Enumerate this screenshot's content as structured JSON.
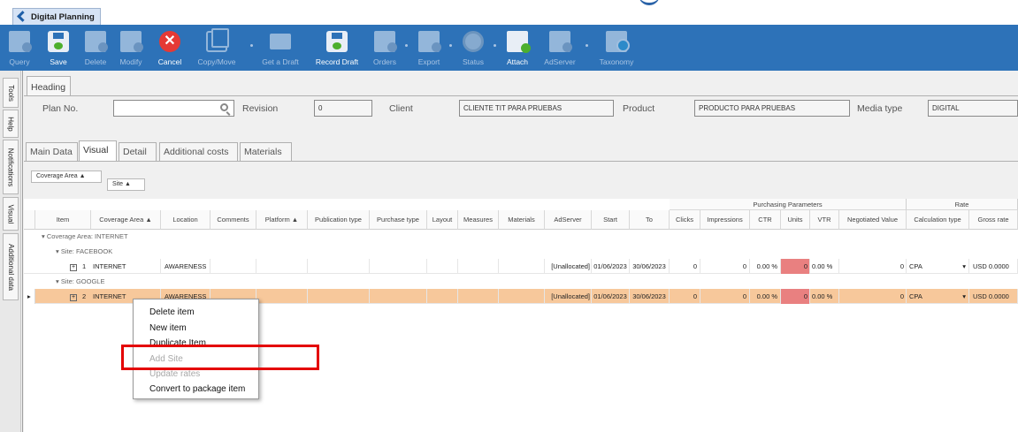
{
  "window": {
    "tab": "Digital Planning"
  },
  "toolbar": [
    {
      "label": "Query",
      "icon": "query-icon",
      "enabled": false
    },
    {
      "label": "Save",
      "icon": "save-icon",
      "enabled": true
    },
    {
      "label": "Delete",
      "icon": "delete-icon",
      "enabled": false
    },
    {
      "label": "Modify",
      "icon": "modify-icon",
      "enabled": false
    },
    {
      "label": "Cancel",
      "icon": "cancel-icon",
      "enabled": true
    },
    {
      "label": "Copy/Move",
      "icon": "copy-icon",
      "enabled": false
    },
    {
      "label": "Get a Draft",
      "icon": "folder-icon",
      "enabled": false
    },
    {
      "label": "Record Draft",
      "icon": "record-draft-icon",
      "enabled": true
    },
    {
      "label": "Orders",
      "icon": "orders-icon",
      "enabled": false
    },
    {
      "label": "Export",
      "icon": "export-icon",
      "enabled": false
    },
    {
      "label": "Status",
      "icon": "status-icon",
      "enabled": false
    },
    {
      "label": "Attach",
      "icon": "attach-icon",
      "enabled": true
    },
    {
      "label": "AdServer",
      "icon": "adserver-icon",
      "enabled": false
    },
    {
      "label": "Taxonomy",
      "icon": "taxonomy-icon",
      "enabled": false
    }
  ],
  "sidebar": [
    "Tools",
    "Help",
    "Notifications",
    "Visual",
    "Additional data"
  ],
  "heading": {
    "tab": "Heading",
    "plan_label": "Plan No.",
    "plan_value": "",
    "revision_label": "Revision",
    "revision_value": "0",
    "client_label": "Client",
    "client_value": "CLIENTE TIT PARA PRUEBAS",
    "product_label": "Product",
    "product_value": "PRODUCTO PARA PRUEBAS",
    "media_label": "Media type",
    "media_value": "DIGITAL"
  },
  "subtabs": [
    "Main Data",
    "Visual",
    "Detail",
    "Additional costs",
    "Materials"
  ],
  "grouping": {
    "chip1": "Coverage Area",
    "chip2": "Site"
  },
  "grid": {
    "bands": {
      "purchasing": "Purchasing Parameters",
      "rate": "Rate"
    },
    "columns": [
      "Item",
      "Coverage Area",
      "Location",
      "Comments",
      "Platform",
      "Publication type",
      "Purchase type",
      "Layout",
      "Measures",
      "Materials",
      "AdServer",
      "Start",
      "To",
      "Clicks",
      "Impressions",
      "CTR",
      "Units",
      "VTR",
      "Negotiated Value",
      "Calculation type",
      "Gross rate"
    ],
    "group_coverage": "Coverage Area: INTERNET",
    "group_site1": "Site: FACEBOOK",
    "group_site2": "Site: GOOGLE",
    "rows": [
      {
        "item": "1",
        "coverage": "INTERNET",
        "location": "AWARENESS",
        "adserver": "[Unallocated]",
        "start": "01/06/2023",
        "to": "30/06/2023",
        "clicks": "0",
        "impressions": "0",
        "ctr": "0.00 %",
        "units": "0",
        "vtr": "0.00 %",
        "negotiated": "0",
        "calc": "CPA",
        "gross": "USD 0.0000"
      },
      {
        "item": "2",
        "coverage": "INTERNET",
        "location": "AWARENESS",
        "adserver": "[Unallocated]",
        "start": "01/06/2023",
        "to": "30/06/2023",
        "clicks": "0",
        "impressions": "0",
        "ctr": "0.00 %",
        "units": "0",
        "vtr": "0.00 %",
        "negotiated": "0",
        "calc": "CPA",
        "gross": "USD 0.0000"
      }
    ]
  },
  "context_menu": [
    {
      "label": "Delete item",
      "enabled": true
    },
    {
      "label": "New item",
      "enabled": true
    },
    {
      "label": "Duplicate Item",
      "enabled": true
    },
    {
      "label": "Add Site",
      "enabled": false
    },
    {
      "label": "Update rates",
      "enabled": false
    },
    {
      "label": "Convert to package item",
      "enabled": true
    }
  ],
  "colors": {
    "ribbon": "#2d72b8",
    "selected_row": "#f7c89b",
    "units_cell": "#e98080",
    "highlight": "#e40000"
  }
}
